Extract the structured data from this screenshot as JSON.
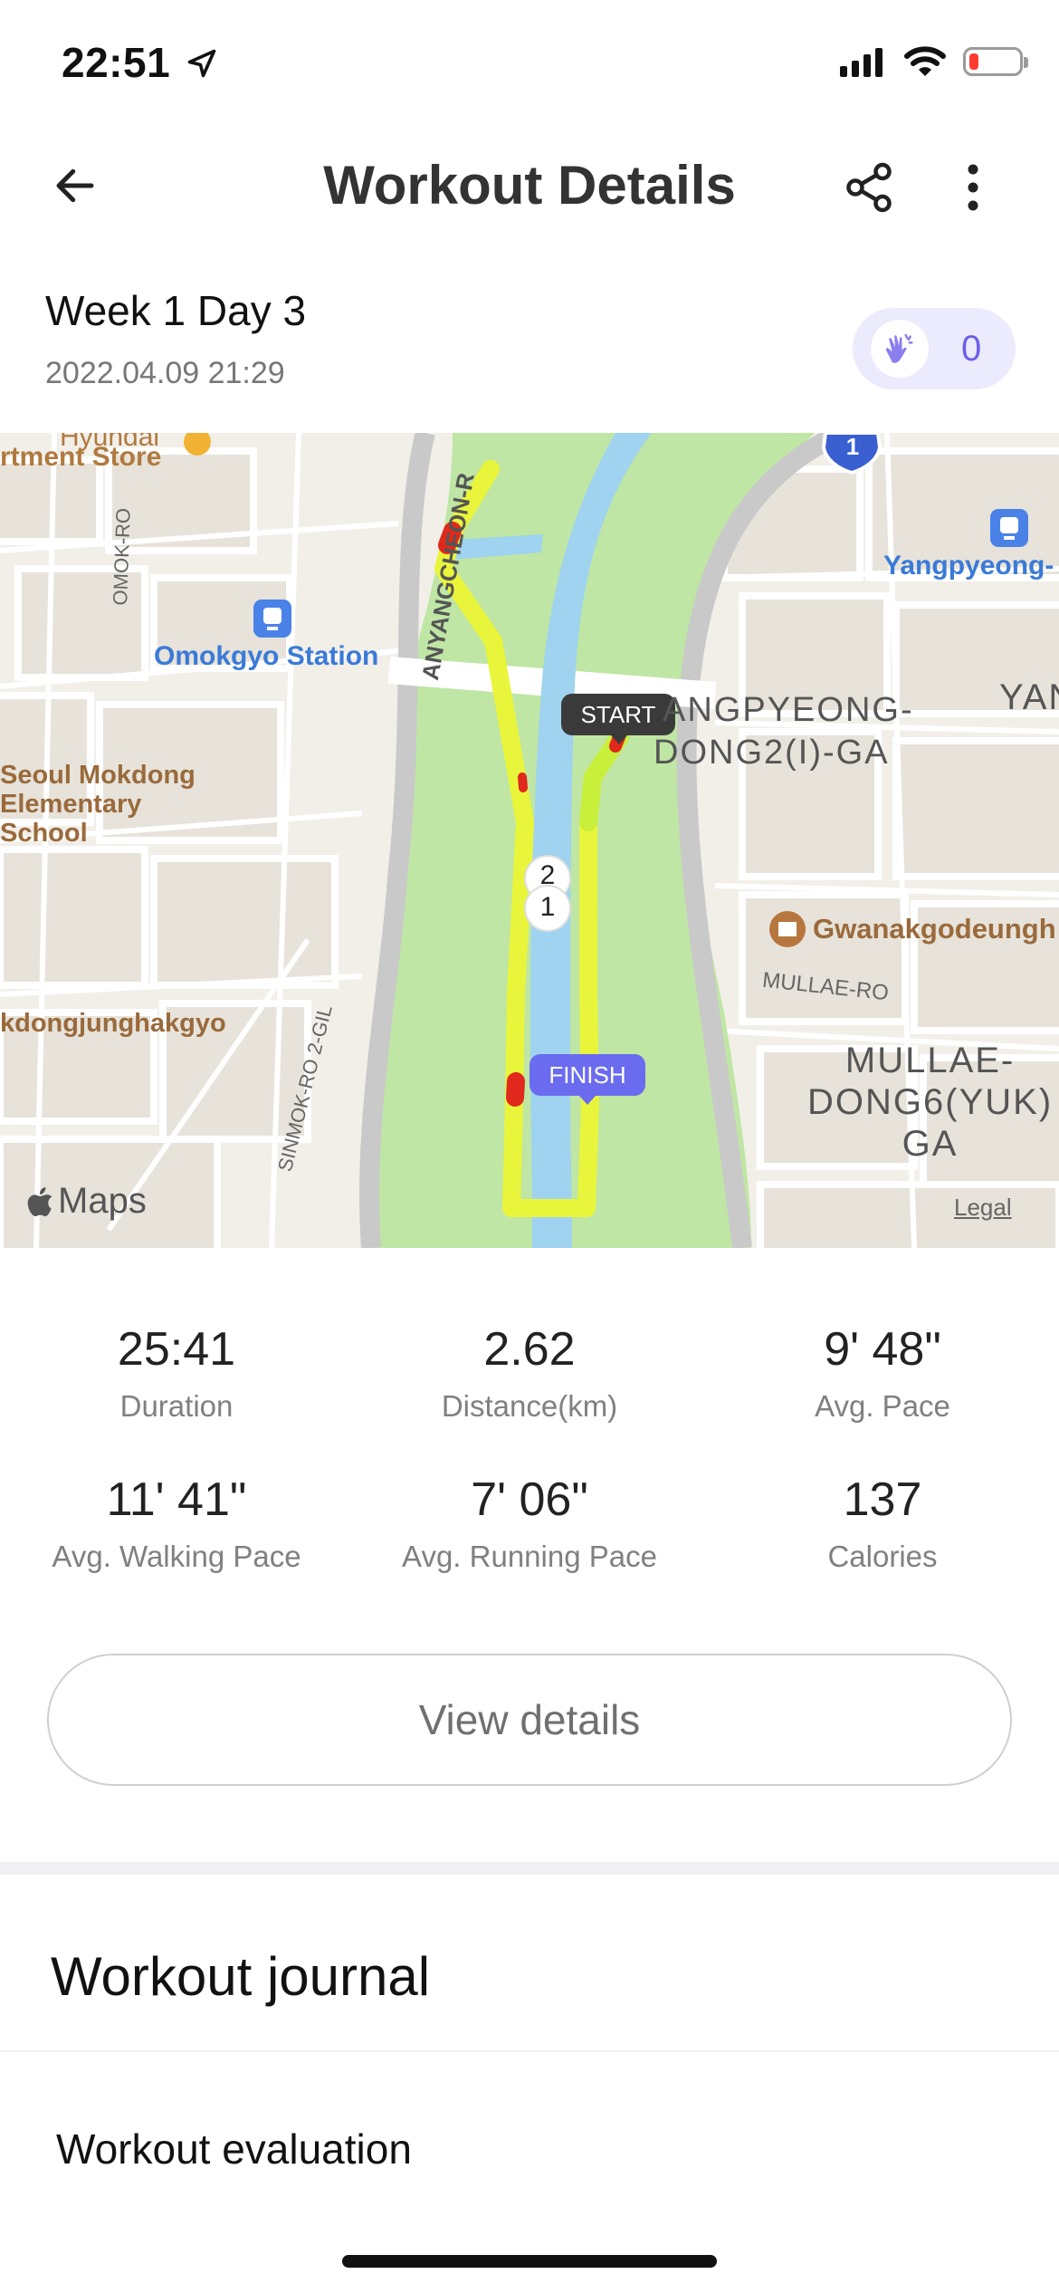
{
  "status_bar": {
    "time": "22:51",
    "battery_color": "#ff3b30",
    "battery_level": 0.18
  },
  "header": {
    "title": "Workout Details",
    "back_icon": "arrow-left-icon",
    "share_icon": "share-icon",
    "more_icon": "more-vertical-icon"
  },
  "workout": {
    "title": "Week 1 Day 3",
    "datetime": "2022.04.09 21:29",
    "clap_count": "0",
    "clap_icon": "clap-hands-icon"
  },
  "map": {
    "labels": {
      "hyundai": "Hyundai",
      "dept_store": "rtment Store",
      "omok_ro": "OMOK-RO",
      "anyangcheon": "ANYANGCHEON-R",
      "omokgyo_station": "Omokgyo Station",
      "yangpyeong": "Yangpyeong-",
      "yan": "YAN",
      "angpyeong": "ANGPYEONG-",
      "dong2": "DONG2(I)-GA",
      "seoul_school_1": "Seoul Mokdong",
      "seoul_school_2": "Elementary",
      "seoul_school_3": "School",
      "gwanak": "Gwanakgodeungh",
      "mullae_ro": "MULLAE-RO",
      "dongjung": "kdongjunghakgyo",
      "sinmok": "SINMOK-RO 2-GIL",
      "mullae_dong_1": "MULLAE-",
      "mullae_dong_2": "DONG6(YUK)",
      "mullae_dong_3": "GA",
      "legal": "Legal",
      "maps_logo": "Maps",
      "route_shield": "1",
      "start": "START",
      "finish": "FINISH",
      "km_marker_top": "2",
      "km_marker_bottom": "1"
    },
    "colors": {
      "river": "#9fd3f0",
      "park": "#bfe6a4",
      "route": "#e9f53a",
      "route_hot": "#e0281c",
      "start_badge": "#3a3a3a",
      "finish_badge": "#6b6bf0"
    }
  },
  "stats": [
    {
      "value": "25:41",
      "label": "Duration"
    },
    {
      "value": "2.62",
      "label": "Distance(km)"
    },
    {
      "value": "9' 48\"",
      "label": "Avg. Pace"
    },
    {
      "value": "11' 41\"",
      "label": "Avg. Walking Pace"
    },
    {
      "value": "7' 06\"",
      "label": "Avg. Running Pace"
    },
    {
      "value": "137",
      "label": "Calories"
    }
  ],
  "actions": {
    "view_details": "View details"
  },
  "journal": {
    "title": "Workout journal",
    "evaluation": "Workout evaluation"
  }
}
